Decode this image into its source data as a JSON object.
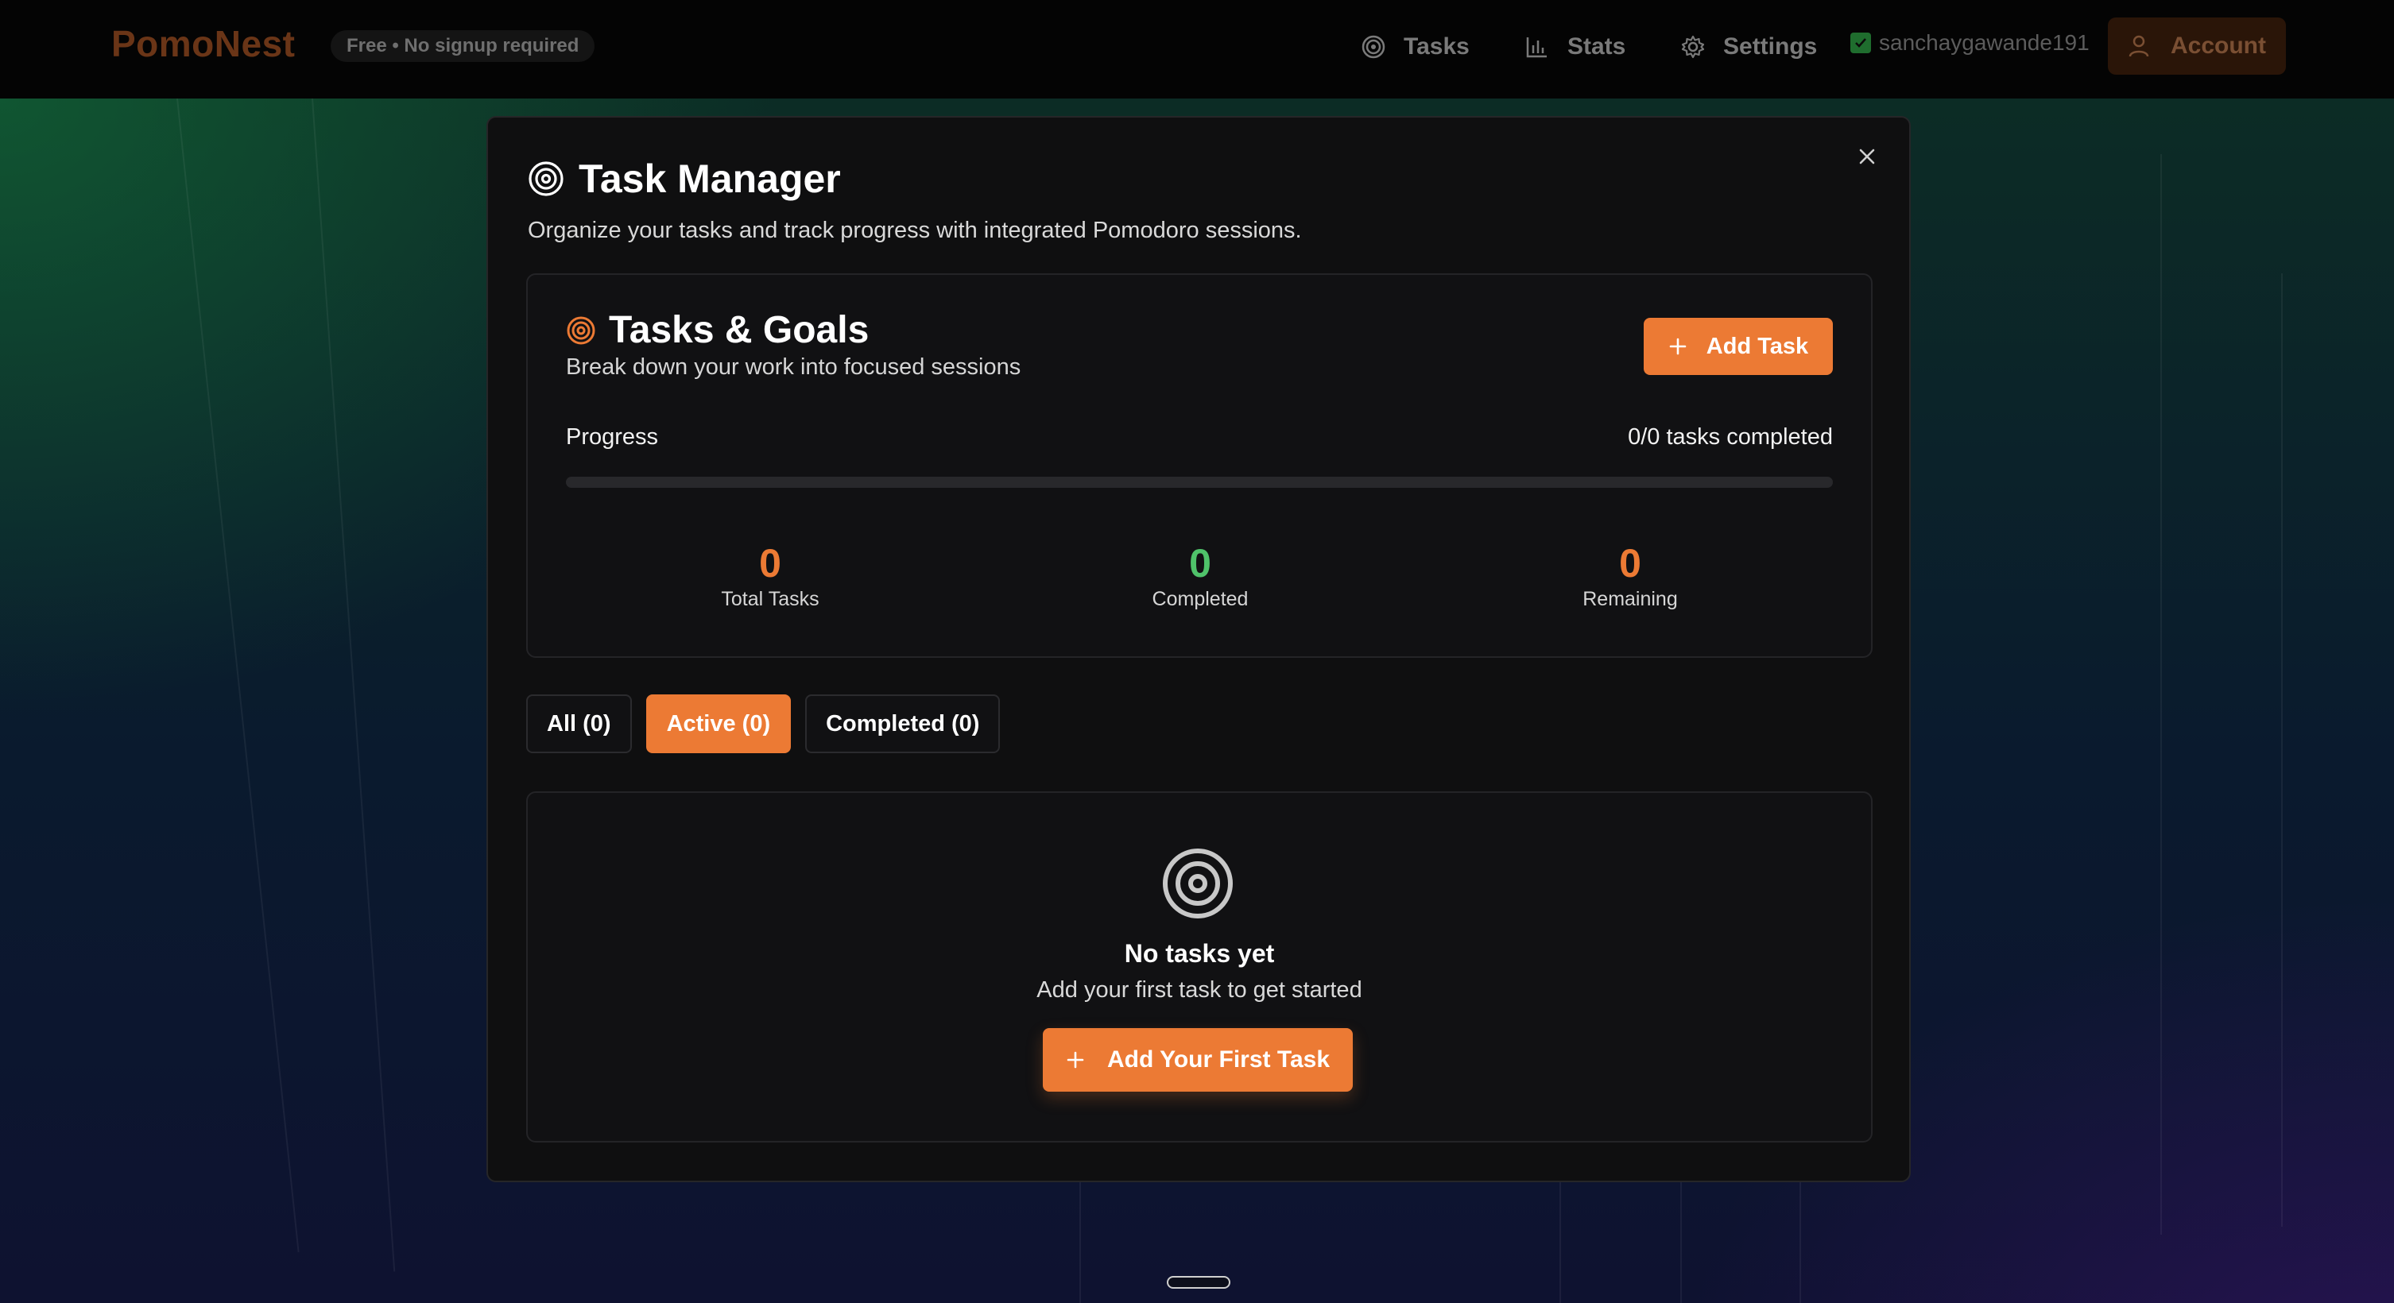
{
  "header": {
    "logo": "PomoNest",
    "badge": "Free • No signup required",
    "nav": [
      {
        "label": "Tasks",
        "icon": "target-icon"
      },
      {
        "label": "Stats",
        "icon": "bar-chart-icon"
      },
      {
        "label": "Settings",
        "icon": "gear-icon"
      }
    ],
    "username": "sanchaygawande191",
    "account_label": "Account"
  },
  "modal": {
    "title": "Task Manager",
    "subtitle": "Organize your tasks and track progress with integrated Pomodoro sessions.",
    "tasks_card": {
      "title": "Tasks & Goals",
      "subtitle": "Break down your work into focused sessions",
      "add_button": "Add Task",
      "progress_label": "Progress",
      "progress_count": "0/0 tasks completed",
      "progress_fraction": 0,
      "stats": [
        {
          "value": "0",
          "label": "Total Tasks",
          "color": "#ec7a34"
        },
        {
          "value": "0",
          "label": "Completed",
          "color": "#4fc26a"
        },
        {
          "value": "0",
          "label": "Remaining",
          "color": "#ec7a34"
        }
      ]
    },
    "filters": [
      {
        "label": "All (0)",
        "active": false
      },
      {
        "label": "Active (0)",
        "active": true
      },
      {
        "label": "Completed (0)",
        "active": false
      }
    ],
    "empty_state": {
      "title": "No tasks yet",
      "subtitle": "Add your first task to get started",
      "button": "Add Your First Task"
    }
  },
  "colors": {
    "accent": "#ec7a34",
    "success": "#4fc26a",
    "modal_bg": "#0f0f10"
  }
}
